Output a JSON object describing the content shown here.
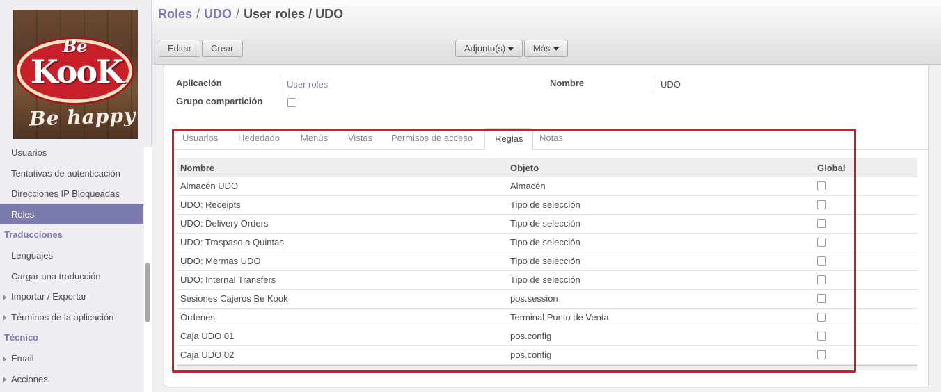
{
  "sidebar": {
    "logo": {
      "top": "Be",
      "main": "KooK",
      "tagline": "Be happy"
    },
    "items": [
      {
        "label": "Usuarios",
        "type": "item"
      },
      {
        "label": "Tentativas de autenticación",
        "type": "item"
      },
      {
        "label": "Direcciones IP Bloqueadas",
        "type": "item"
      },
      {
        "label": "Roles",
        "type": "active"
      },
      {
        "label": "Traducciones",
        "type": "section"
      },
      {
        "label": "Lenguajes",
        "type": "item"
      },
      {
        "label": "Cargar una traducción",
        "type": "item"
      },
      {
        "label": "Importar / Exportar",
        "type": "expandable"
      },
      {
        "label": "Términos de la aplicación",
        "type": "expandable"
      },
      {
        "label": "Técnico",
        "type": "section"
      },
      {
        "label": "Email",
        "type": "expandable"
      },
      {
        "label": "Acciones",
        "type": "expandable"
      }
    ]
  },
  "breadcrumb": {
    "c1": "Roles",
    "c2": "UDO",
    "current": "User roles / UDO",
    "sep": "/"
  },
  "toolbar": {
    "edit": "Editar",
    "create": "Crear",
    "attachments": "Adjunto(s)",
    "more": "Más"
  },
  "form": {
    "app_label": "Aplicación",
    "app_value": "User roles",
    "share_label": "Grupo compartición",
    "share_checked": false,
    "name_label": "Nombre",
    "name_value": "UDO"
  },
  "tabs": [
    "Usuarios",
    "Hededado",
    "Menús",
    "Vistas",
    "Permisos de acceso",
    "Reglas",
    "Notas"
  ],
  "active_tab": "Reglas",
  "grid": {
    "headers": {
      "name": "Nombre",
      "object": "Objeto",
      "global": "Global"
    },
    "rows": [
      {
        "name": "Almacén UDO",
        "object": "Almacén",
        "global": false
      },
      {
        "name": "UDO: Receipts",
        "object": "Tipo de selección",
        "global": false
      },
      {
        "name": "UDO: Delivery Orders",
        "object": "Tipo de selección",
        "global": false
      },
      {
        "name": "UDO: Traspaso a Quintas",
        "object": "Tipo de selección",
        "global": false
      },
      {
        "name": "UDO: Mermas UDO",
        "object": "Tipo de selección",
        "global": false
      },
      {
        "name": "UDO: Internal Transfers",
        "object": "Tipo de selección",
        "global": false
      },
      {
        "name": "Sesiones Cajeros Be Kook",
        "object": "pos.session",
        "global": false
      },
      {
        "name": "Órdenes",
        "object": "Terminal Punto de Venta",
        "global": false
      },
      {
        "name": "Caja UDO 01",
        "object": "pos.config",
        "global": false
      },
      {
        "name": "Caja UDO 02",
        "object": "pos.config",
        "global": false
      }
    ]
  },
  "colors": {
    "accent": "#7c7bad",
    "highlight": "#e8101c"
  }
}
